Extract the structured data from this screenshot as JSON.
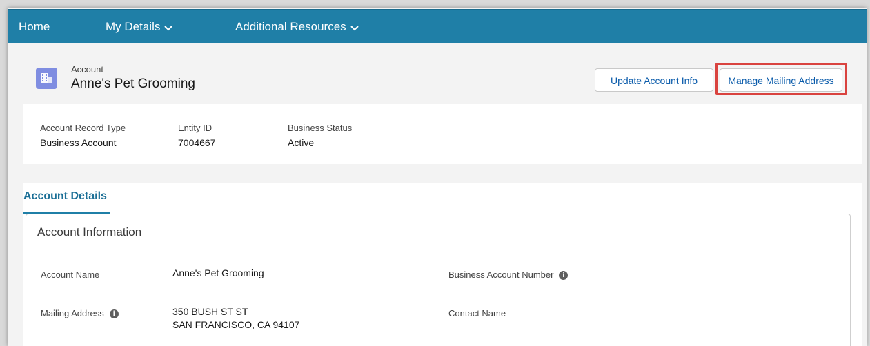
{
  "nav": {
    "home": "Home",
    "my_details": "My Details",
    "additional_resources": "Additional Resources"
  },
  "header": {
    "object_type": "Account",
    "account_name": "Anne's Pet Grooming",
    "update_button": "Update Account Info",
    "mailing_button": "Manage Mailing Address"
  },
  "summary": {
    "fields": [
      {
        "label": "Account Record Type",
        "value": "Business Account"
      },
      {
        "label": "Entity ID",
        "value": "7004667"
      },
      {
        "label": "Business Status",
        "value": "Active"
      }
    ]
  },
  "tabs": {
    "active": "Account Details"
  },
  "details": {
    "section_title": "Account Information",
    "account_name_label": "Account Name",
    "account_name_value": "Anne's Pet Grooming",
    "mailing_address_label": "Mailing Address",
    "mailing_address_line1": "350 BUSH ST ST",
    "mailing_address_line2": "SAN FRANCISCO, CA 94107",
    "business_account_number_label": "Business Account Number",
    "contact_name_label": "Contact Name"
  },
  "colors": {
    "nav_bg": "#1f7fa7",
    "highlight": "#d9433f",
    "link": "#0b5cab",
    "account_icon": "#7f8de1"
  },
  "icons": {
    "account": "account-building-icon",
    "chevron": "chevron-down-icon",
    "info": "info-icon"
  }
}
